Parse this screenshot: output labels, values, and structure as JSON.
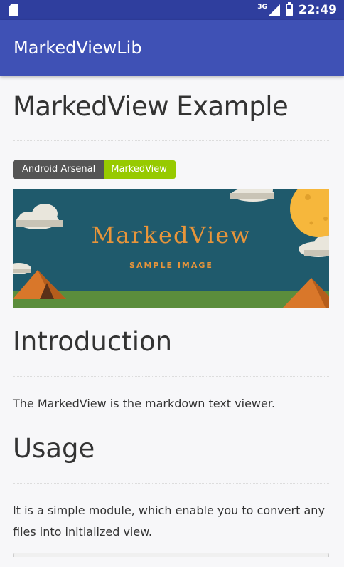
{
  "status_bar": {
    "network": "3G",
    "time": "22:49"
  },
  "app_bar": {
    "title": "MarkedViewLib"
  },
  "document": {
    "heading": "MarkedView Example",
    "badge": {
      "left": "Android Arsenal",
      "right": "MarkedView",
      "left_color": "#555555",
      "right_color": "#97ca00"
    },
    "banner": {
      "title": "MarkedView",
      "subtitle": "SAMPLE IMAGE"
    },
    "sections": [
      {
        "title": "Introduction",
        "text": "The MarkedView is the markdown text viewer."
      },
      {
        "title": "Usage",
        "text": "It is a simple module, which enable you to convert any files into initialized view."
      }
    ]
  },
  "colors": {
    "status_bar": "#2f3e9e",
    "app_bar": "#3f51b5",
    "banner_bg": "#1f5a6c",
    "banner_text": "#e8953a"
  }
}
